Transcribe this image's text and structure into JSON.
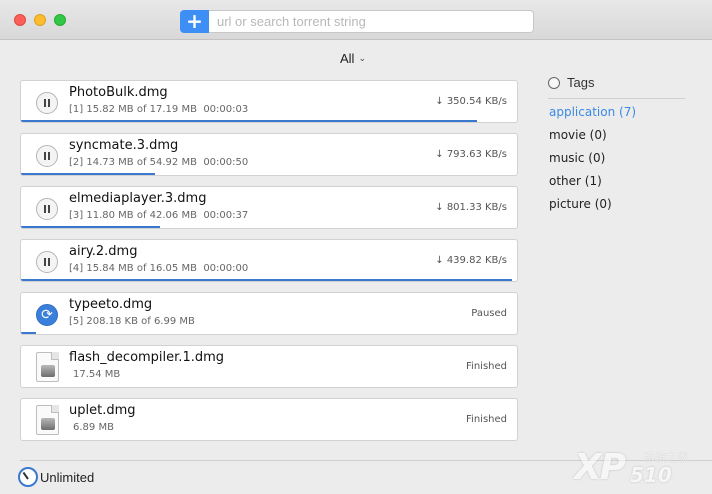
{
  "search": {
    "add_label": "+",
    "placeholder": "url or search torrent string"
  },
  "filter": {
    "label": "All",
    "chevron": "⌄"
  },
  "torrents": [
    {
      "name": "PhotoBulk.dmg",
      "index": "[1]",
      "size_text": "15.82 MB of 17.19 MB",
      "time": "00:00:03",
      "status": "↓ 350.54 KB/s",
      "state": "downloading",
      "progress": 0.92
    },
    {
      "name": "syncmate.3.dmg",
      "index": "[2]",
      "size_text": "14.73 MB of 54.92 MB",
      "time": "00:00:50",
      "status": "↓ 793.63 KB/s",
      "state": "downloading",
      "progress": 0.27
    },
    {
      "name": "elmediaplayer.3.dmg",
      "index": "[3]",
      "size_text": "11.80 MB of 42.06 MB",
      "time": "00:00:37",
      "status": "↓ 801.33 KB/s",
      "state": "downloading",
      "progress": 0.28
    },
    {
      "name": "airy.2.dmg",
      "index": "[4]",
      "size_text": "15.84 MB of 16.05 MB",
      "time": "00:00:00",
      "status": "↓ 439.82 KB/s",
      "state": "downloading",
      "progress": 0.99
    },
    {
      "name": "typeeto.dmg",
      "index": "[5]",
      "size_text": "208.18 KB of 6.99 MB",
      "time": "",
      "status": "Paused",
      "state": "paused",
      "progress": 0.03
    },
    {
      "name": "flash_decompiler.1.dmg",
      "index": "",
      "size_text": "17.54 MB",
      "time": "",
      "status": "Finished",
      "state": "finished",
      "progress": 0
    },
    {
      "name": "uplet.dmg",
      "index": "",
      "size_text": "6.89 MB",
      "time": "",
      "status": "Finished",
      "state": "finished",
      "progress": 0
    }
  ],
  "tags": {
    "title": "Tags",
    "items": [
      {
        "label": "application (7)",
        "active": true
      },
      {
        "label": "movie (0)",
        "active": false
      },
      {
        "label": "music (0)",
        "active": false
      },
      {
        "label": "other (1)",
        "active": false
      },
      {
        "label": "picture (0)",
        "active": false
      }
    ]
  },
  "footer": {
    "speed_label": "Unlimited"
  },
  "watermark": {
    "brand": "XP",
    "number": "510",
    "cn": "系统之家"
  },
  "colors": {
    "accent": "#3a78cf",
    "tag_active": "#3b8ae4",
    "add_button": "#3d8ff5"
  }
}
